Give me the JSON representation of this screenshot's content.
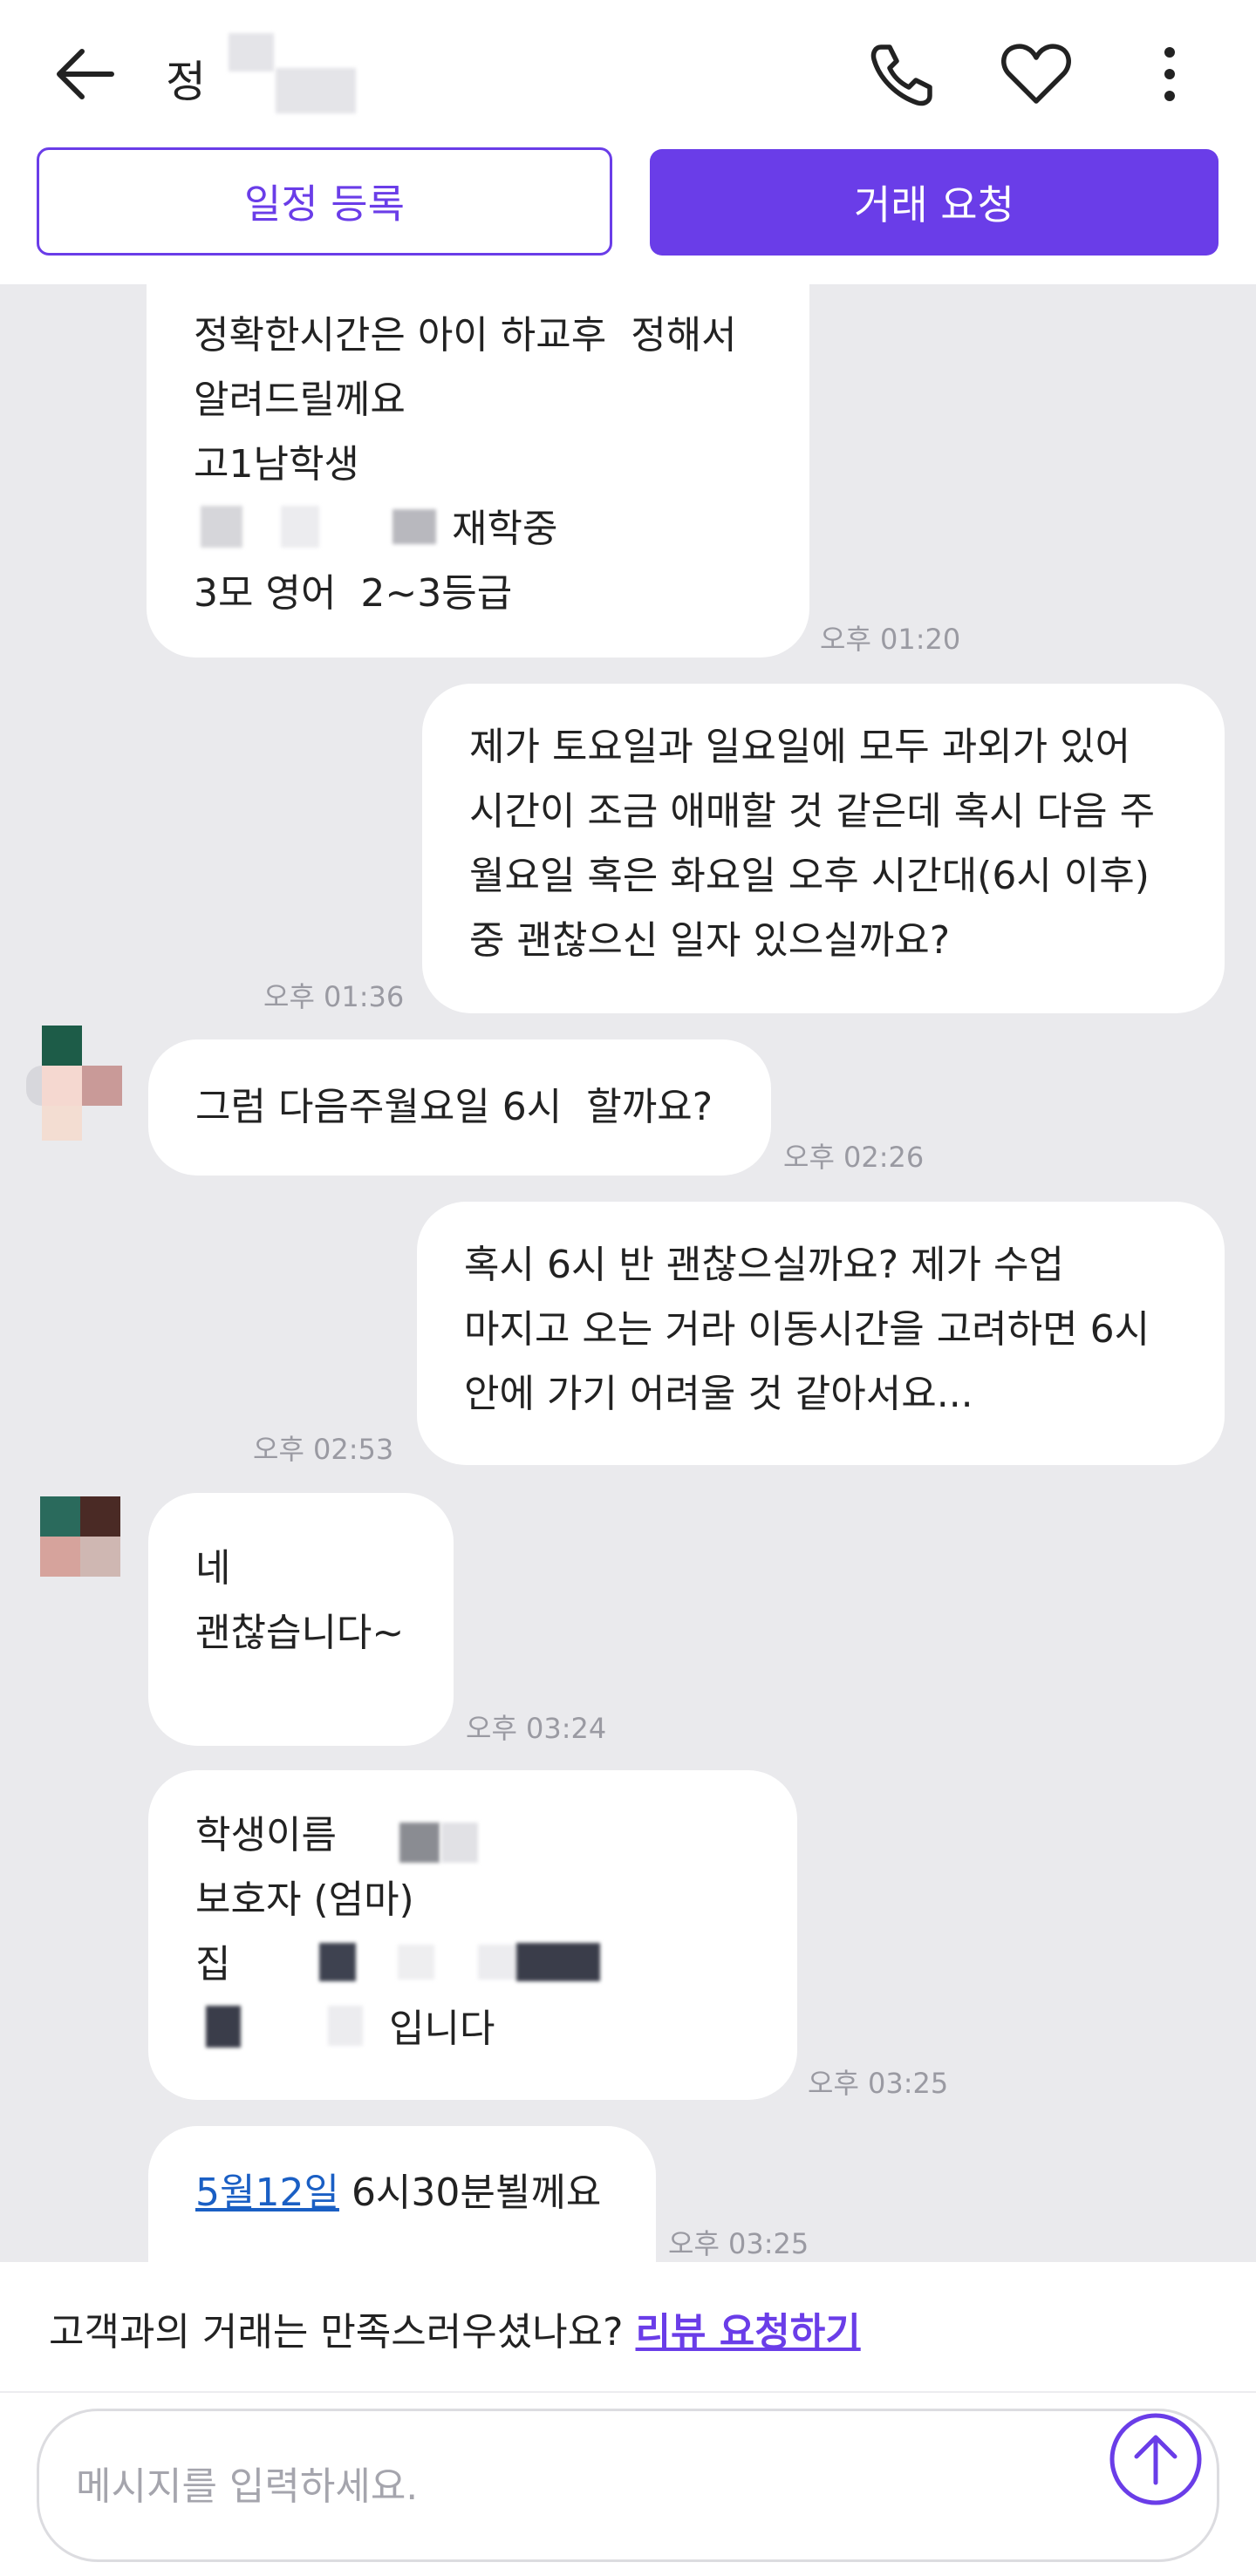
{
  "header": {
    "contact_name": "정",
    "schedule_button": "일정 등록",
    "trade_button": "거래 요청"
  },
  "messages": [
    {
      "lines": [
        "정확한시간은 아이 하교후  정해서",
        "알려드릴께요",
        "고1남학생",
        "재학중",
        "3모 영어  2~3등급"
      ],
      "time": "오후 01:20"
    },
    {
      "lines": [
        "제가 토요일과 일요일에 모두 과외가 있어",
        "시간이 조금 애매할 것 같은데 혹시 다음 주",
        "월요일 혹은 화요일 오후 시간대(6시 이후)",
        "중 괜찮으신 일자 있으실까요?"
      ],
      "time": "오후 01:36"
    },
    {
      "lines": [
        "그럼 다음주월요일 6시  할까요?"
      ],
      "time": "오후 02:26"
    },
    {
      "lines": [
        "혹시 6시 반 괜찮으실까요? 제가 수업",
        "마지고 오는 거라 이동시간을 고려하면 6시",
        "안에 가기 어려울 것 같아서요..."
      ],
      "time": "오후 02:53"
    },
    {
      "lines": [
        "네",
        "괜찮습니다~"
      ],
      "time": "오후 03:24"
    },
    {
      "lines": [
        "학생이름",
        "보호자 (엄마)",
        "집",
        "입니다"
      ],
      "time": "오후 03:25"
    },
    {
      "link": "5월12일",
      "text": " 6시30분뵐께요",
      "time": "오후 03:25"
    }
  ],
  "review": {
    "question": "고객과의 거래는 만족스러우셨나요? ",
    "link": "리뷰 요청하기"
  },
  "composer": {
    "placeholder": "메시지를 입력하세요."
  },
  "colors": {
    "accent": "#6a3de8",
    "chat_background": "#eaeaed",
    "link": "#1a5fc4"
  },
  "icons": [
    "back-arrow-icon",
    "phone-icon",
    "heart-icon",
    "more-vertical-icon",
    "send-arrow-icon"
  ]
}
